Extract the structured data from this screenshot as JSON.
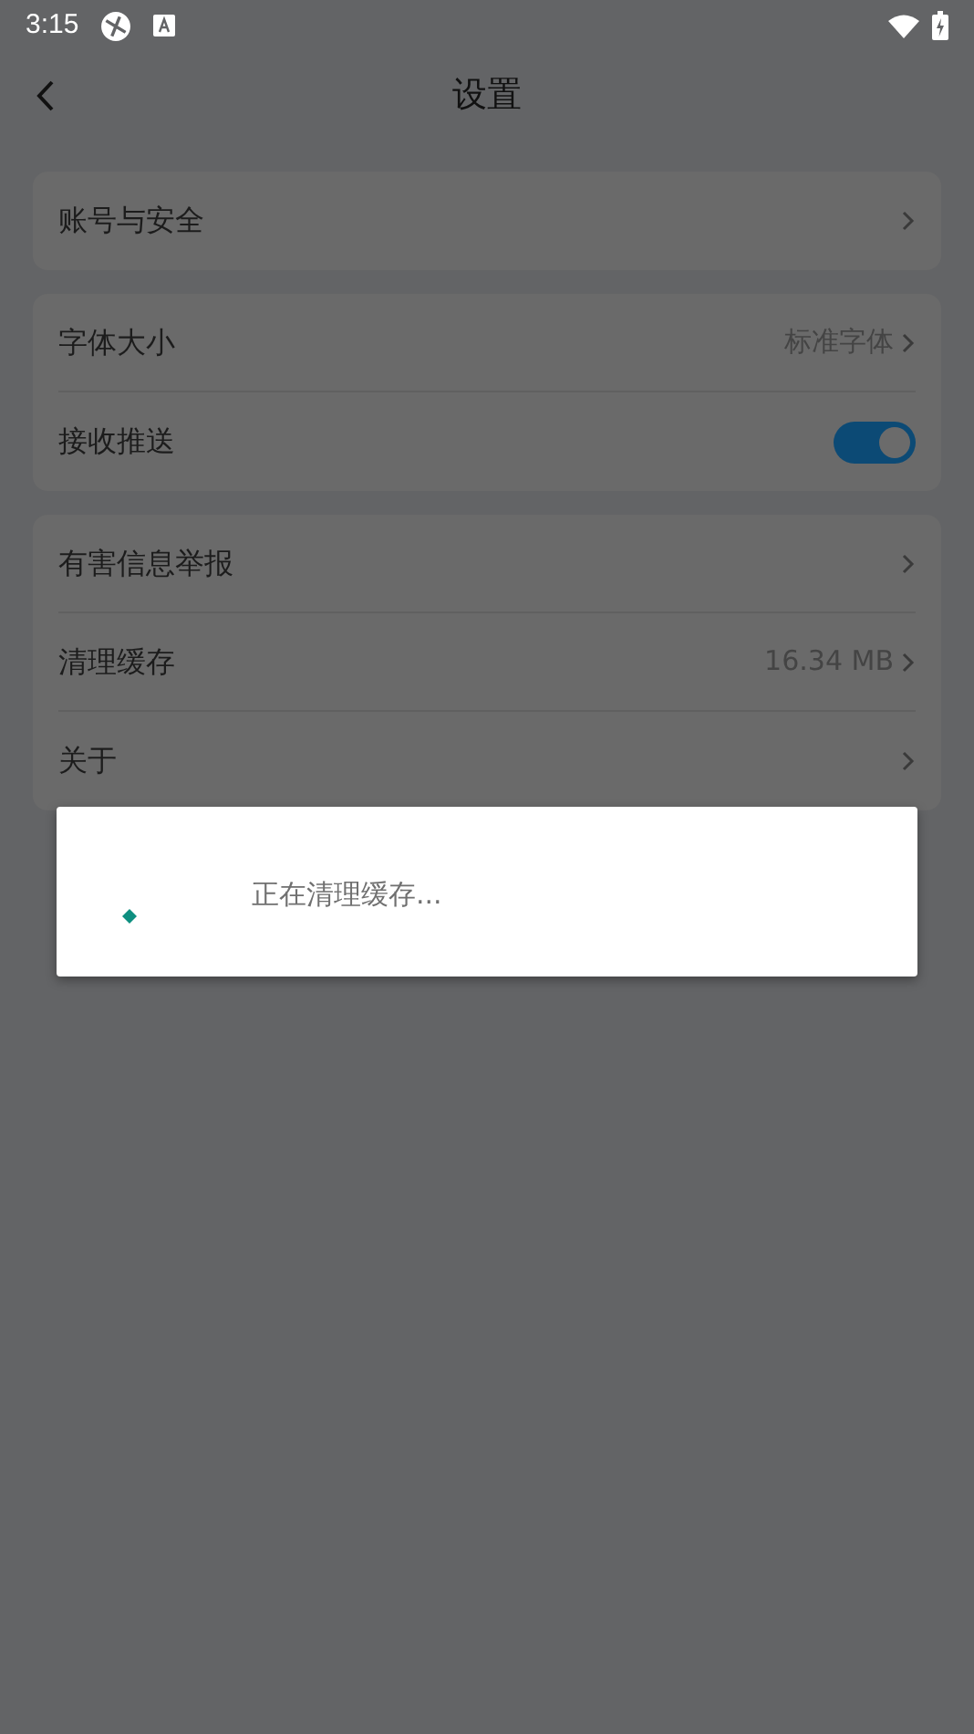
{
  "status_bar": {
    "time": "3:15"
  },
  "header": {
    "title": "设置"
  },
  "groups": [
    {
      "rows": [
        {
          "kind": "link",
          "label": "账号与安全"
        }
      ]
    },
    {
      "rows": [
        {
          "kind": "link",
          "label": "字体大小",
          "value": "标准字体"
        },
        {
          "kind": "toggle",
          "label": "接收推送",
          "on": true
        }
      ]
    },
    {
      "rows": [
        {
          "kind": "link",
          "label": "有害信息举报"
        },
        {
          "kind": "link",
          "label": "清理缓存",
          "value": "16.34 MB"
        },
        {
          "kind": "link",
          "label": "关于"
        }
      ]
    }
  ],
  "dialog": {
    "message": "正在清理缓存..."
  }
}
